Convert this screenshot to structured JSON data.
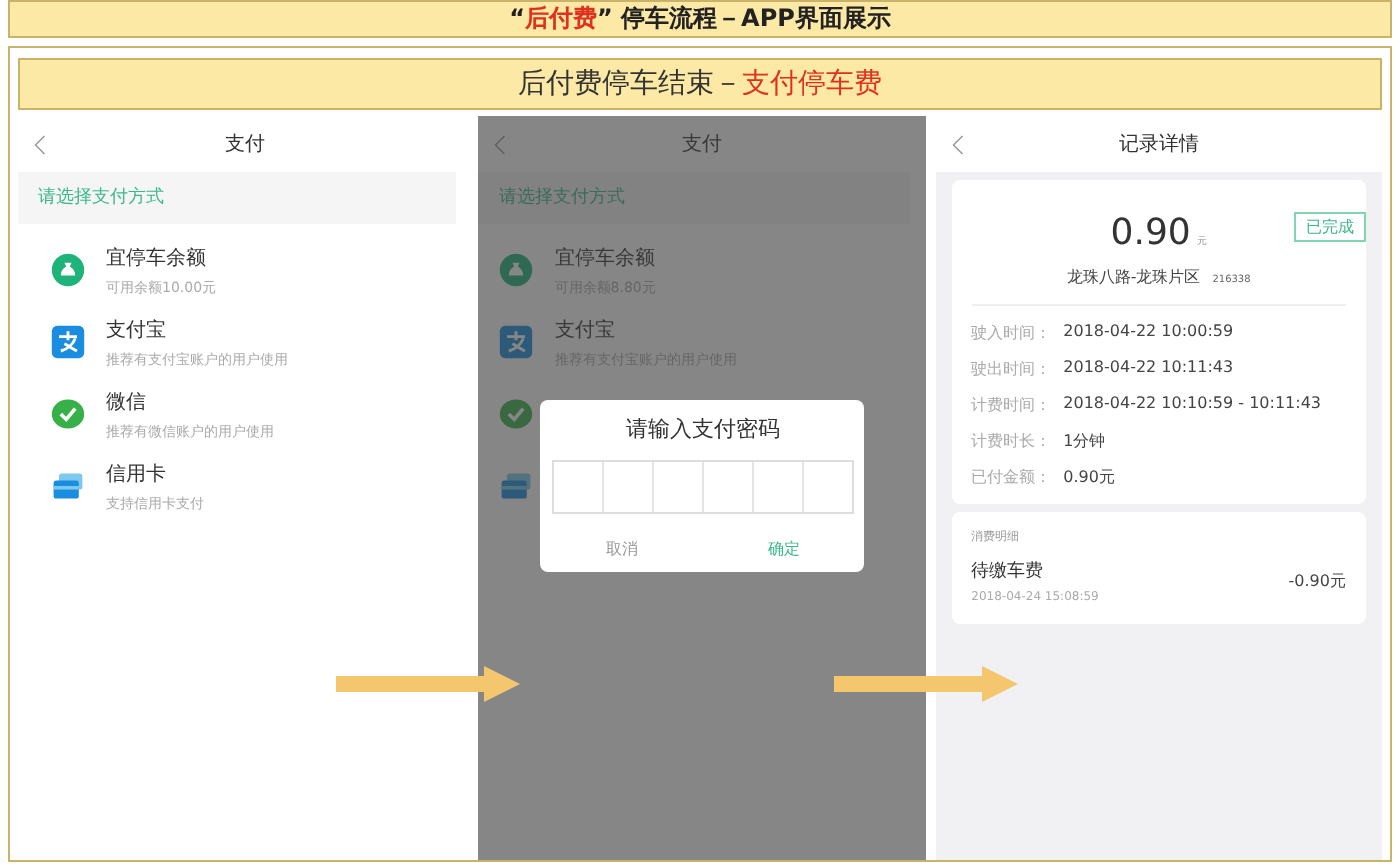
{
  "banner": {
    "parts": [
      {
        "text": "“",
        "emphasis": false
      },
      {
        "text": "后付费",
        "emphasis": true
      },
      {
        "text": "” 停车流程－APP界面展示",
        "emphasis": false
      }
    ]
  },
  "subtitle": {
    "parts": [
      {
        "text": "后付费停车结束－",
        "emphasis": false
      },
      {
        "text": "支付停车费",
        "emphasis": true
      }
    ]
  },
  "payment_screen": {
    "title": "支付",
    "section": "请选择支付方式",
    "methods": [
      {
        "kind": "balance",
        "title": "宜停车余额",
        "subtitle": "可用余额10.00元"
      },
      {
        "kind": "alipay",
        "title": "支付宝",
        "subtitle": "推荐有支付宝账户的用户使用"
      },
      {
        "kind": "wechat",
        "title": "微信",
        "subtitle": "推荐有微信账户的用户使用"
      },
      {
        "kind": "card",
        "title": "信用卡",
        "subtitle": "支持信用卡支付"
      }
    ]
  },
  "password_screen": {
    "title": "支付",
    "section": "请选择支付方式",
    "methods": [
      {
        "kind": "balance",
        "title": "宜停车余额",
        "subtitle": "可用余额8.80元"
      },
      {
        "kind": "alipay",
        "title": "支付宝",
        "subtitle": "推荐有支付宝账户的用户使用"
      },
      {
        "kind": "wechat"
      },
      {
        "kind": "card"
      }
    ],
    "dialog": {
      "title": "请输入支付密码",
      "buttons": [
        {
          "label": "取消",
          "kind": "cancel"
        },
        {
          "label": "确定",
          "kind": "confirm"
        }
      ]
    }
  },
  "record_screen": {
    "title": "记录详情",
    "amount": "0.90",
    "unit": "元",
    "status": "已完成",
    "location": "龙珠八路-龙珠片区",
    "code": "216338",
    "rows": [
      {
        "label": "驶入时间：",
        "value": "2018-04-22 10:00:59"
      },
      {
        "label": "驶出时间：",
        "value": "2018-04-22 10:11:43"
      },
      {
        "label": "计费时间：",
        "value": "2018-04-22 10:10:59 - 10:11:43"
      },
      {
        "label": "计费时长：",
        "value": "1分钟"
      },
      {
        "label": "已付金额：",
        "value": "0.90元"
      }
    ],
    "details": {
      "heading": "消费明细",
      "item": "待缴车费",
      "date": "2018-04-24 15:08:59",
      "amount": "-0.90元"
    }
  }
}
